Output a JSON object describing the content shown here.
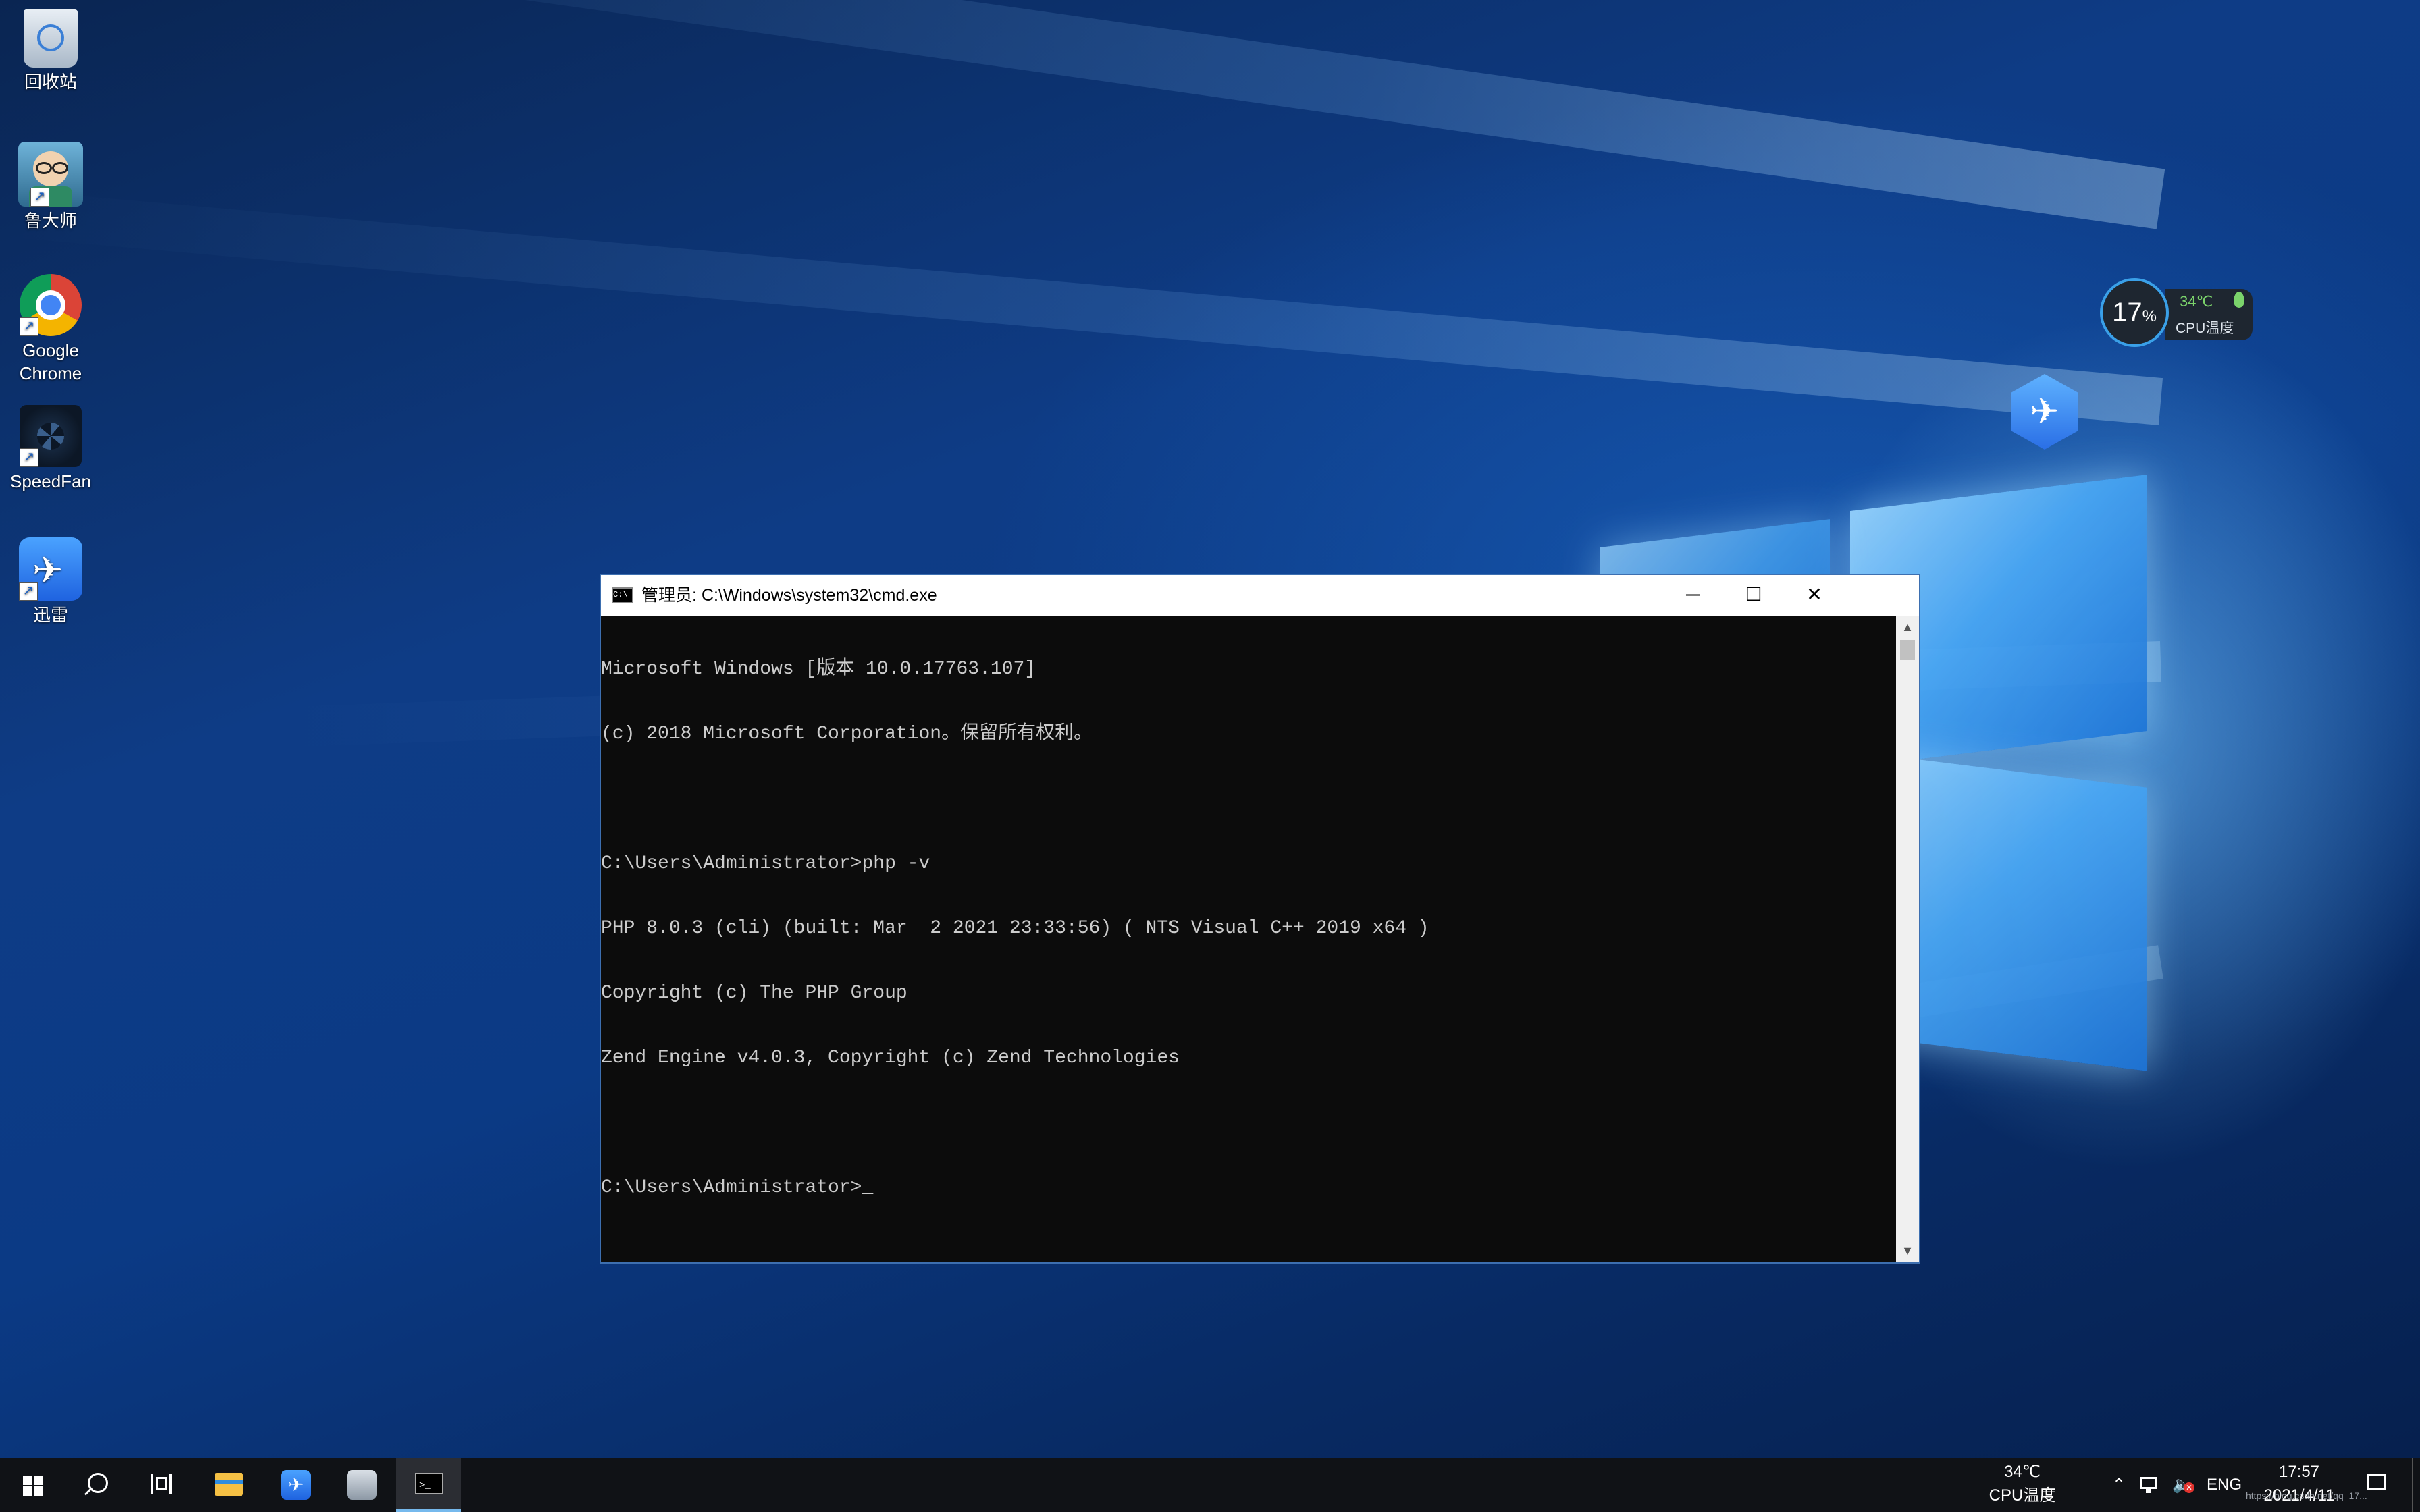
{
  "desktop_icons": [
    {
      "label": "回收站",
      "icon": "recycle-bin-icon"
    },
    {
      "label": "鲁大师",
      "icon": "ludashi-icon"
    },
    {
      "label": "Google Chrome",
      "icon": "chrome-icon"
    },
    {
      "label": "SpeedFan",
      "icon": "speedfan-icon"
    },
    {
      "label": "迅雷",
      "icon": "thunder-icon"
    }
  ],
  "cpu_gadget": {
    "usage": "17",
    "usage_unit": "%",
    "temp": "34℃",
    "label": "CPU温度"
  },
  "cmd_window": {
    "title": "管理员: C:\\Windows\\system32\\cmd.exe",
    "lines": [
      "Microsoft Windows [版本 10.0.17763.107]",
      "(c) 2018 Microsoft Corporation。保留所有权利。",
      "",
      "C:\\Users\\Administrator>php -v",
      "PHP 8.0.3 (cli) (built: Mar  2 2021 23:33:56) ( NTS Visual C++ 2019 x64 )",
      "Copyright (c) The PHP Group",
      "Zend Engine v4.0.3, Copyright (c) Zend Technologies",
      "",
      "C:\\Users\\Administrator>_"
    ],
    "minimize_glyph": "─",
    "maximize_glyph": "☐",
    "close_glyph": "✕"
  },
  "taskbar": {
    "apps": [
      "start-icon",
      "search-icon",
      "task-view-icon",
      "file-explorer-icon",
      "thunder-icon",
      "ludashi-icon",
      "cmd-icon"
    ],
    "tray": {
      "cpu_temp": "34℃",
      "cpu_label": "CPU温度",
      "lang": "ENG",
      "time": "17:57",
      "date": "2021/4/11",
      "watermark": "https://blog.csdn.net/qq_17..."
    }
  },
  "colors": {
    "cmd_bg": "#0c0c0c",
    "cmd_text": "#cccccc",
    "taskbar_bg": "#101216",
    "accent": "#3aa0e8"
  }
}
